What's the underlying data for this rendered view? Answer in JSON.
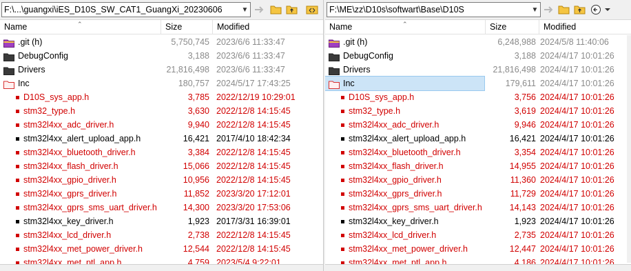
{
  "left": {
    "path": "F:\\...\\guangxi\\iES_D10S_SW_CAT1_GuangXi_20230606",
    "columns": {
      "name": "Name",
      "size": "Size",
      "modified": "Modified"
    },
    "rows": [
      {
        "name": ".git (h)",
        "size": "5,750,745",
        "modified": "2023/6/6 11:33:47",
        "kind": "git-folder",
        "color": "gray"
      },
      {
        "name": "DebugConfig",
        "size": "3,188",
        "modified": "2023/6/6 11:33:47",
        "kind": "folder",
        "color": "gray"
      },
      {
        "name": "Drivers",
        "size": "21,816,498",
        "modified": "2023/6/6 11:33:47",
        "kind": "folder",
        "color": "gray"
      },
      {
        "name": "Inc",
        "size": "180,757",
        "modified": "2024/5/17 17:43:25",
        "kind": "red-folder",
        "color": "gray"
      },
      {
        "name": "D10S_sys_app.h",
        "size": "3,785",
        "modified": "2022/12/19 10:29:01",
        "kind": "red-file",
        "color": "red"
      },
      {
        "name": "stm32_type.h",
        "size": "3,630",
        "modified": "2022/12/8 14:15:45",
        "kind": "red-file",
        "color": "red"
      },
      {
        "name": "stm32l4xx_adc_driver.h",
        "size": "9,940",
        "modified": "2022/12/8 14:15:45",
        "kind": "red-file",
        "color": "red"
      },
      {
        "name": "stm32l4xx_alert_upload_app.h",
        "size": "16,421",
        "modified": "2017/4/10 18:42:34",
        "kind": "black-file",
        "color": "black"
      },
      {
        "name": "stm32l4xx_bluetooth_driver.h",
        "size": "3,384",
        "modified": "2022/12/8 14:15:45",
        "kind": "red-file",
        "color": "red"
      },
      {
        "name": "stm32l4xx_flash_driver.h",
        "size": "15,066",
        "modified": "2022/12/8 14:15:45",
        "kind": "red-file",
        "color": "red"
      },
      {
        "name": "stm32l4xx_gpio_driver.h",
        "size": "10,956",
        "modified": "2022/12/8 14:15:45",
        "kind": "red-file",
        "color": "red"
      },
      {
        "name": "stm32l4xx_gprs_driver.h",
        "size": "11,852",
        "modified": "2023/3/20 17:12:01",
        "kind": "red-file",
        "color": "red"
      },
      {
        "name": "stm32l4xx_gprs_sms_uart_driver.h",
        "size": "14,300",
        "modified": "2023/3/20 17:53:06",
        "kind": "red-file",
        "color": "red"
      },
      {
        "name": "stm32l4xx_key_driver.h",
        "size": "1,923",
        "modified": "2017/3/31 16:39:01",
        "kind": "black-file",
        "color": "black"
      },
      {
        "name": "stm32l4xx_lcd_driver.h",
        "size": "2,738",
        "modified": "2022/12/8 14:15:45",
        "kind": "red-file",
        "color": "red"
      },
      {
        "name": "stm32l4xx_met_power_driver.h",
        "size": "12,544",
        "modified": "2022/12/8 14:15:45",
        "kind": "red-file",
        "color": "red"
      },
      {
        "name": "stm32l4xx_met_ptl_app.h",
        "size": "4,759",
        "modified": "2023/5/4 9:22:01",
        "kind": "red-file",
        "color": "red"
      }
    ]
  },
  "right": {
    "path": "F:\\ME\\zz\\D10s\\softwart\\Base\\D10S",
    "columns": {
      "name": "Name",
      "size": "Size",
      "modified": "Modified"
    },
    "rows": [
      {
        "name": ".git (h)",
        "size": "6,248,988",
        "modified": "2024/5/8 11:40:06",
        "kind": "git-folder",
        "color": "gray"
      },
      {
        "name": "DebugConfig",
        "size": "3,188",
        "modified": "2024/4/17 10:01:26",
        "kind": "folder",
        "color": "gray"
      },
      {
        "name": "Drivers",
        "size": "21,816,498",
        "modified": "2024/4/17 10:01:26",
        "kind": "folder",
        "color": "gray"
      },
      {
        "name": "Inc",
        "size": "179,611",
        "modified": "2024/4/17 10:01:26",
        "kind": "red-folder",
        "color": "gray",
        "selected": true
      },
      {
        "name": "D10S_sys_app.h",
        "size": "3,756",
        "modified": "2024/4/17 10:01:26",
        "kind": "red-file",
        "color": "red"
      },
      {
        "name": "stm32_type.h",
        "size": "3,619",
        "modified": "2024/4/17 10:01:26",
        "kind": "red-file",
        "color": "red"
      },
      {
        "name": "stm32l4xx_adc_driver.h",
        "size": "9,946",
        "modified": "2024/4/17 10:01:26",
        "kind": "red-file",
        "color": "red"
      },
      {
        "name": "stm32l4xx_alert_upload_app.h",
        "size": "16,421",
        "modified": "2024/4/17 10:01:26",
        "kind": "black-file",
        "color": "black"
      },
      {
        "name": "stm32l4xx_bluetooth_driver.h",
        "size": "3,354",
        "modified": "2024/4/17 10:01:26",
        "kind": "red-file",
        "color": "red"
      },
      {
        "name": "stm32l4xx_flash_driver.h",
        "size": "14,955",
        "modified": "2024/4/17 10:01:26",
        "kind": "red-file",
        "color": "red"
      },
      {
        "name": "stm32l4xx_gpio_driver.h",
        "size": "11,360",
        "modified": "2024/4/17 10:01:26",
        "kind": "red-file",
        "color": "red"
      },
      {
        "name": "stm32l4xx_gprs_driver.h",
        "size": "11,729",
        "modified": "2024/4/17 10:01:26",
        "kind": "red-file",
        "color": "red"
      },
      {
        "name": "stm32l4xx_gprs_sms_uart_driver.h",
        "size": "14,143",
        "modified": "2024/4/17 10:01:26",
        "kind": "red-file",
        "color": "red"
      },
      {
        "name": "stm32l4xx_key_driver.h",
        "size": "1,923",
        "modified": "2024/4/17 10:01:26",
        "kind": "black-file",
        "color": "black"
      },
      {
        "name": "stm32l4xx_lcd_driver.h",
        "size": "2,735",
        "modified": "2024/4/17 10:01:26",
        "kind": "red-file",
        "color": "red"
      },
      {
        "name": "stm32l4xx_met_power_driver.h",
        "size": "12,447",
        "modified": "2024/4/17 10:01:26",
        "kind": "red-file",
        "color": "red"
      },
      {
        "name": "stm32l4xx_met_ptl_app.h",
        "size": "4,186",
        "modified": "2024/4/17 10:01:26",
        "kind": "red-file",
        "color": "red"
      }
    ]
  },
  "colors": {
    "red": "#d10000",
    "gray": "#8a8a8a",
    "selection": "#cce4f7",
    "folder": "#3a3a3a",
    "git_folder": "#a040c0",
    "red_folder": "#d83030"
  },
  "icons": {
    "left_toolbar": [
      "swap-arrow-icon",
      "open-folder-icon",
      "parent-folder-icon",
      "sync-compare-icon"
    ],
    "right_toolbar": [
      "swap-arrow-icon",
      "open-folder-icon",
      "parent-folder-icon",
      "back-circle-icon",
      "forward-dropdown-icon"
    ]
  }
}
